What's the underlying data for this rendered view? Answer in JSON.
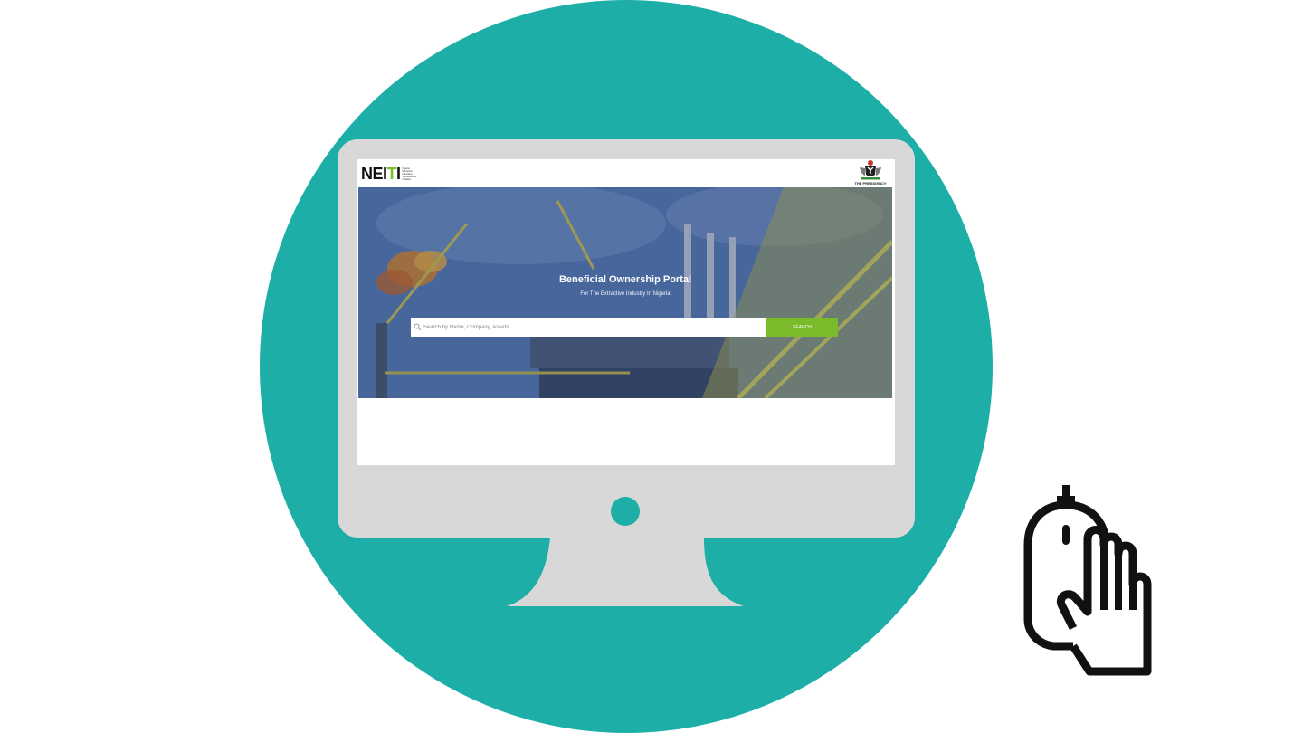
{
  "site": {
    "logo": {
      "brand_black": "NEI",
      "brand_green": "T",
      "brand_black_end": "I",
      "tagline": [
        "Nigeria",
        "Extractive",
        "Industries",
        "Transparency",
        "Initiative"
      ]
    },
    "presidency_label": "THE PRESIDENCY"
  },
  "hero": {
    "title": "Beneficial Ownership Portal",
    "subtitle": "For The Extractive Industry In Nigeria"
  },
  "search": {
    "placeholder": "Search by Name, Company, Assets..",
    "button_label": "SEARCH"
  },
  "icons": {
    "search": "search-icon",
    "mouse": "mouse-with-hand-icon",
    "presidency": "coat-of-arms-icon"
  },
  "colors": {
    "teal": "#1daea8",
    "monitor": "#d8d8d8",
    "search_button": "#79bb2b",
    "brand_green": "#7dbd2e"
  }
}
